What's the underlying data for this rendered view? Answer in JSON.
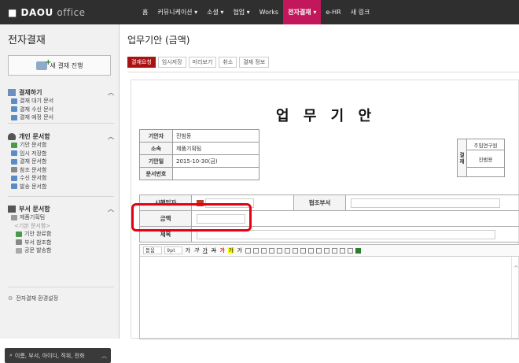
{
  "app": {
    "logo_bold": "DAOU",
    "logo_light": "office"
  },
  "topnav": [
    "홈",
    "커뮤니케이션 ▾",
    "소셜 ▾",
    "협업 ▾",
    "Works",
    "전자결재 ▾",
    "e-HR",
    "새 링크"
  ],
  "sidebar": {
    "title": "전자결재",
    "new_button": "새 결재 진행",
    "sections": [
      {
        "title": "결재하기",
        "items": [
          "결재 대기 문서",
          "결재 수신 문서",
          "결재 예정 문서"
        ]
      },
      {
        "title": "개인 문서함",
        "items": [
          "기안 문서함",
          "임시 저장함",
          "결재 문서함",
          "참조 문서함",
          "수신 문서함",
          "발송 문서함"
        ]
      },
      {
        "title": "부서 문서함",
        "dept": "제품기획팀",
        "dept_group": "<기본 문서함>",
        "items": [
          "기안 완료함",
          "부서 참조함",
          "공문 발송함"
        ]
      }
    ],
    "settings": "전자결재 환경설정",
    "search": "이름, 부서, 아이디, 직위, 전화"
  },
  "main": {
    "title": "업무기안 (금액)",
    "toolbar": [
      "결재요청",
      "임시저장",
      "미리보기",
      "취소",
      "결재 정보"
    ],
    "doc_title": "업 무 기 안",
    "info": [
      {
        "label": "기안자",
        "value": "진범동"
      },
      {
        "label": "소속",
        "value": "제품기획팀"
      },
      {
        "label": "기안일",
        "value": "2015-10-30(금)"
      },
      {
        "label": "문서번호",
        "value": ""
      }
    ],
    "approval": {
      "side": "결재",
      "role": "주임연구원",
      "name": "진범용"
    },
    "exec": {
      "date_label": "시행일자",
      "coop_label": "협조부서",
      "amount_label": "금액",
      "subject_label": "제목"
    },
    "editor": {
      "font": "돋움",
      "size": "9pt",
      "buttons": [
        "가",
        "가",
        "가",
        "가",
        "가",
        "가",
        "가"
      ]
    }
  },
  "colors": {
    "topbar": "#2f2f2f",
    "accent": "#c2185b",
    "highlight": "#e60012",
    "primary_btn": "#aa1111"
  }
}
